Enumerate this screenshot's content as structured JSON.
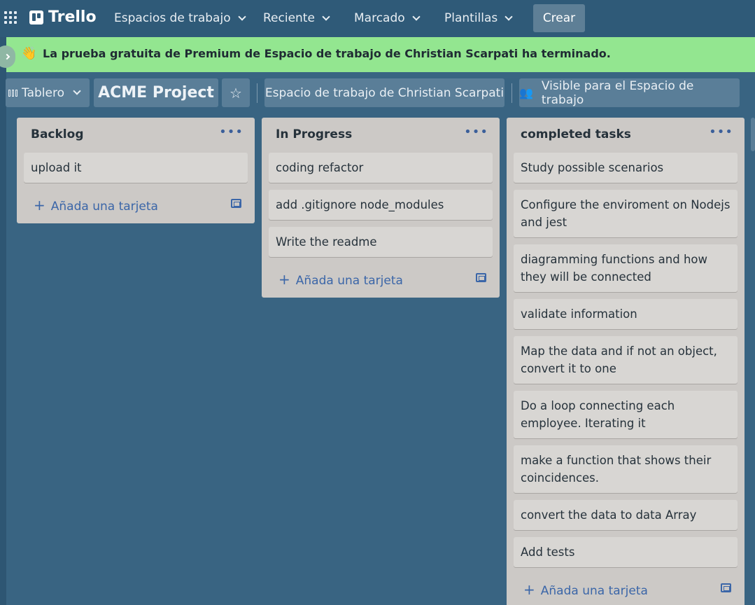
{
  "nav": {
    "logo": "Trello",
    "items": [
      {
        "label": "Espacios de trabajo"
      },
      {
        "label": "Reciente"
      },
      {
        "label": "Marcado"
      },
      {
        "label": "Plantillas"
      }
    ],
    "create_label": "Crear"
  },
  "banner": {
    "emoji": "👋",
    "text": "La prueba gratuita de Premium de Espacio de trabajo de Christian Scarpati ha terminado."
  },
  "board": {
    "view_label": "Tablero",
    "title": "ACME Project",
    "workspace_label": "Espacio de trabajo de Christian Scarpati",
    "visibility_label": "Visible para el Espacio de trabajo"
  },
  "lists": [
    {
      "title": "Backlog",
      "cards": [
        "upload it"
      ],
      "add_label": "Añada una tarjeta"
    },
    {
      "title": "In Progress",
      "cards": [
        "coding refactor",
        "add .gitignore node_modules",
        "Write the readme"
      ],
      "add_label": "Añada una tarjeta"
    },
    {
      "title": "completed tasks",
      "cards": [
        "Study possible scenarios",
        "Configure the enviroment on Nodejs and jest",
        "diagramming functions and how they will be connected",
        "validate information",
        "Map the data and if not an object, convert it to one",
        "Do a loop connecting each employee. Iterating it",
        "make a function that shows their coincidences.",
        "convert the data to data Array",
        "Add tests"
      ],
      "add_label": "Añada una tarjeta"
    }
  ],
  "colors": {
    "board_background": "#396482",
    "banner_background": "#93e690",
    "list_background": "#ccc9c6",
    "link_blue": "#3b66a8"
  }
}
